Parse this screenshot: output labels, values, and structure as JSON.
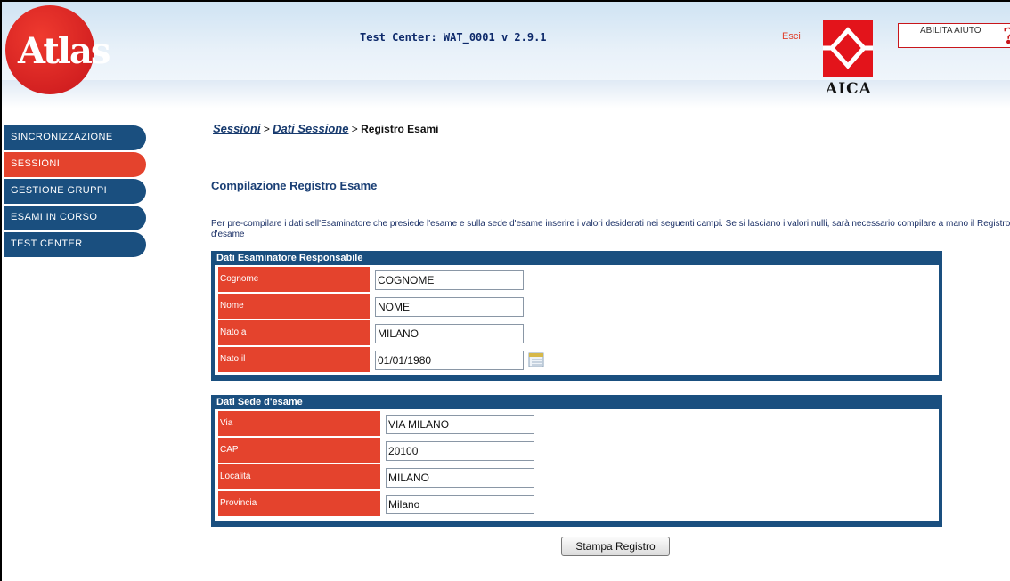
{
  "header": {
    "title": "Test Center: WAT_0001 v 2.9.1",
    "exit_label": "Esci",
    "help_label": "ABILITA AIUTO",
    "help_icon": "?",
    "atlas_logo_text": "Atlas",
    "aica_logo_text": "AICA"
  },
  "nav": {
    "items": [
      {
        "label": "SINCRONIZZAZIONE"
      },
      {
        "label": "SESSIONI"
      },
      {
        "label": "GESTIONE GRUPPI"
      },
      {
        "label": "ESAMI IN CORSO"
      },
      {
        "label": "TEST CENTER"
      }
    ]
  },
  "breadcrumb": {
    "sessions": "Sessioni",
    "session_data": "Dati Sessione",
    "current": "Registro Esami",
    "sep": ">"
  },
  "main": {
    "title": "Compilazione Registro Esame",
    "intro": "Per pre-compilare i dati sell'Esaminatore che presiede l'esame e sulla sede d'esame inserire i valori desiderati nei seguenti campi. Se si lasciano i valori nulli, sarà necessario compilare a mano il Registro d'esame"
  },
  "examiner": {
    "heading": "Dati Esaminatore Responsabile",
    "fields": [
      {
        "label": "Cognome",
        "value": "COGNOME"
      },
      {
        "label": "Nome",
        "value": "NOME"
      },
      {
        "label": "Nato a",
        "value": "MILANO"
      },
      {
        "label": "Nato il",
        "value": "01/01/1980"
      }
    ]
  },
  "venue": {
    "heading": "Dati Sede d'esame",
    "fields": [
      {
        "label": "Via",
        "value": "VIA MILANO"
      },
      {
        "label": "CAP",
        "value": "20100"
      },
      {
        "label": "Località",
        "value": "MILANO"
      },
      {
        "label": "Provincia",
        "value": "Milano"
      }
    ]
  },
  "actions": {
    "print_label": "Stampa Registro"
  },
  "colors": {
    "nav_blue": "#1a4f7f",
    "accent_red": "#e4432d",
    "title_blue": "#1a3f75"
  }
}
